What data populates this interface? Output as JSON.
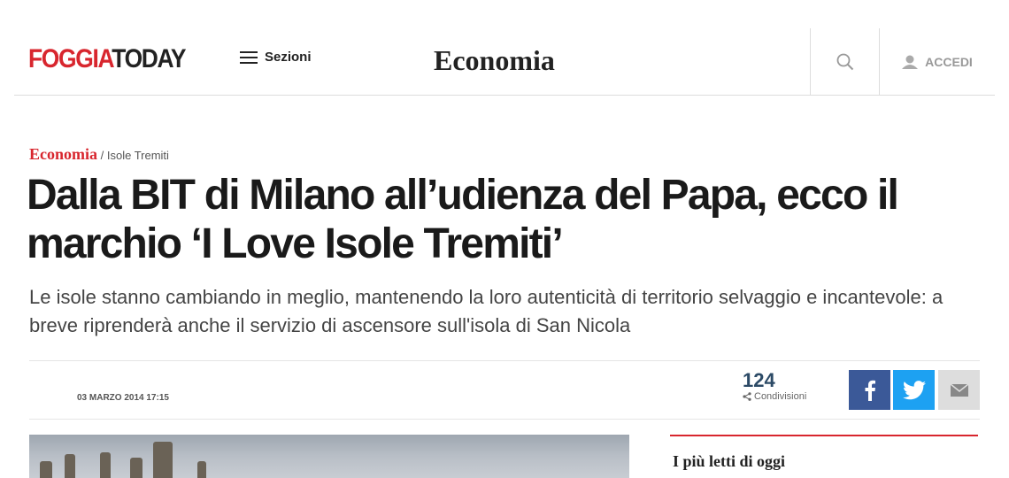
{
  "header": {
    "logo_red": "FOGGIA",
    "logo_dark": "TODAY",
    "sezioni_label": "Sezioni",
    "section_title": "Economia",
    "login_label": "ACCEDI"
  },
  "article": {
    "breadcrumb_category": "Economia",
    "breadcrumb_sep": " / ",
    "breadcrumb_sub": "Isole Tremiti",
    "headline": "Dalla BIT di Milano all’udienza del Papa, ecco il marchio ‘I Love Isole Tremiti’",
    "subtitle": "Le isole stanno cambiando in meglio, mantenendo la loro autenticità di territorio selvaggio e incantevole: a breve riprenderà anche il servizio di ascensore sull'isola di San Nicola",
    "date": "03 MARZO 2014 17:15",
    "share_count": "124",
    "share_label": "Condivisioni"
  },
  "sidebar": {
    "title": "I più letti di oggi"
  },
  "colors": {
    "brand_red": "#d8262e",
    "facebook": "#3b5998",
    "twitter": "#1da1f2",
    "share_count": "#2c4a66"
  },
  "icons": {
    "menu": "hamburger-icon",
    "search": "search-icon",
    "user": "user-icon",
    "share": "share-icon",
    "facebook": "facebook-icon",
    "twitter": "twitter-icon",
    "mail": "mail-icon"
  }
}
